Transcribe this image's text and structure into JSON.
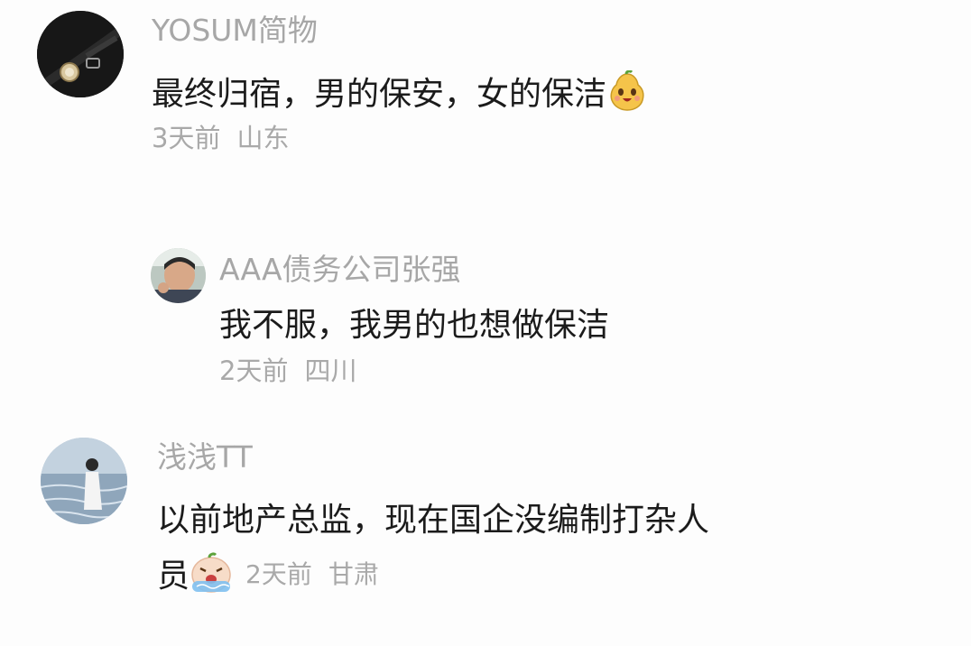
{
  "comments": [
    {
      "username": "YOSUM简物",
      "text": "最终归宿，男的保安，女的保洁",
      "emoji": "smiling-pear-sticker-icon",
      "time": "3天前",
      "location": "山东"
    },
    {
      "username": "AAA债务公司张强",
      "text": "我不服，我男的也想做保洁",
      "time": "2天前",
      "location": "四川"
    },
    {
      "username": "浅浅TT",
      "text_line1": "以前地产总监，现在国企没编制打杂人",
      "text_line2": "员",
      "emoji": "crying-bubble-sticker-icon",
      "time": "2天前",
      "location": "甘肃"
    }
  ],
  "colors": {
    "username": "#a7a7a7",
    "text": "#1b1b1b",
    "meta": "#a9a9a9",
    "background": "#fdfdfd"
  }
}
